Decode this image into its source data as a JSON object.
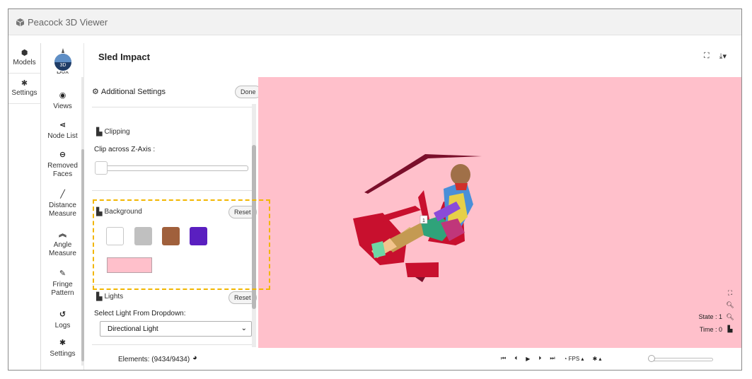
{
  "app": {
    "title": "Peacock 3D Viewer",
    "logo_label": "3D"
  },
  "left_nav": [
    {
      "label": "Models",
      "icon": "cube-icon",
      "glyph": "⬢"
    },
    {
      "label": "Settings",
      "icon": "gear-icon",
      "glyph": "✱"
    }
  ],
  "tools": {
    "cut_label": "Box",
    "items": [
      {
        "label": "Views",
        "icon": "eye-icon",
        "glyph": "◉"
      },
      {
        "label": "Node List",
        "icon": "share-icon",
        "glyph": "⋖"
      },
      {
        "label": "Removed Faces",
        "icon": "minus-circle-icon",
        "glyph": "⊖"
      },
      {
        "label": "Distance Measure",
        "icon": "ruler-icon",
        "glyph": "╱"
      },
      {
        "label": "Angle Measure",
        "icon": "angle-icon",
        "glyph": "︽"
      },
      {
        "label": "Fringe Pattern",
        "icon": "dropper-icon",
        "glyph": "✎"
      },
      {
        "label": "Logs",
        "icon": "history-icon",
        "glyph": "↺"
      },
      {
        "label": "Settings",
        "icon": "gear-icon",
        "glyph": "✱"
      }
    ]
  },
  "header": {
    "title": "Sled Impact",
    "fullscreen_icon": "⛶",
    "download_icon": "⤓▾"
  },
  "panel": {
    "title": "Additional Settings",
    "done_label": "Done",
    "clipping": {
      "title": "Clipping",
      "axis_label": "Clip across Z-Axis :",
      "value": 0
    },
    "background": {
      "title": "Background",
      "reset_label": "Reset",
      "swatches": [
        "#ffffff",
        "#c0c0c0",
        "#a0603c",
        "#5a1fc0"
      ],
      "current_color": "#ffc0cb"
    },
    "lights": {
      "title": "Lights",
      "reset_label": "Reset",
      "select_label": "Select Light From Dropdown:",
      "selected": "Directional Light"
    }
  },
  "footer": {
    "elements_text": "Elements: (9434/9434)"
  },
  "viewport": {
    "background": "#ffc0cb",
    "state_text": "State : 1",
    "time_text": "Time : 0",
    "marker_label": "1"
  },
  "playback": {
    "first": "⏮",
    "prev": "⏴",
    "play": "▶",
    "next": "⏵",
    "last": "⏭",
    "fps_label": "FPS",
    "progress": 0
  }
}
